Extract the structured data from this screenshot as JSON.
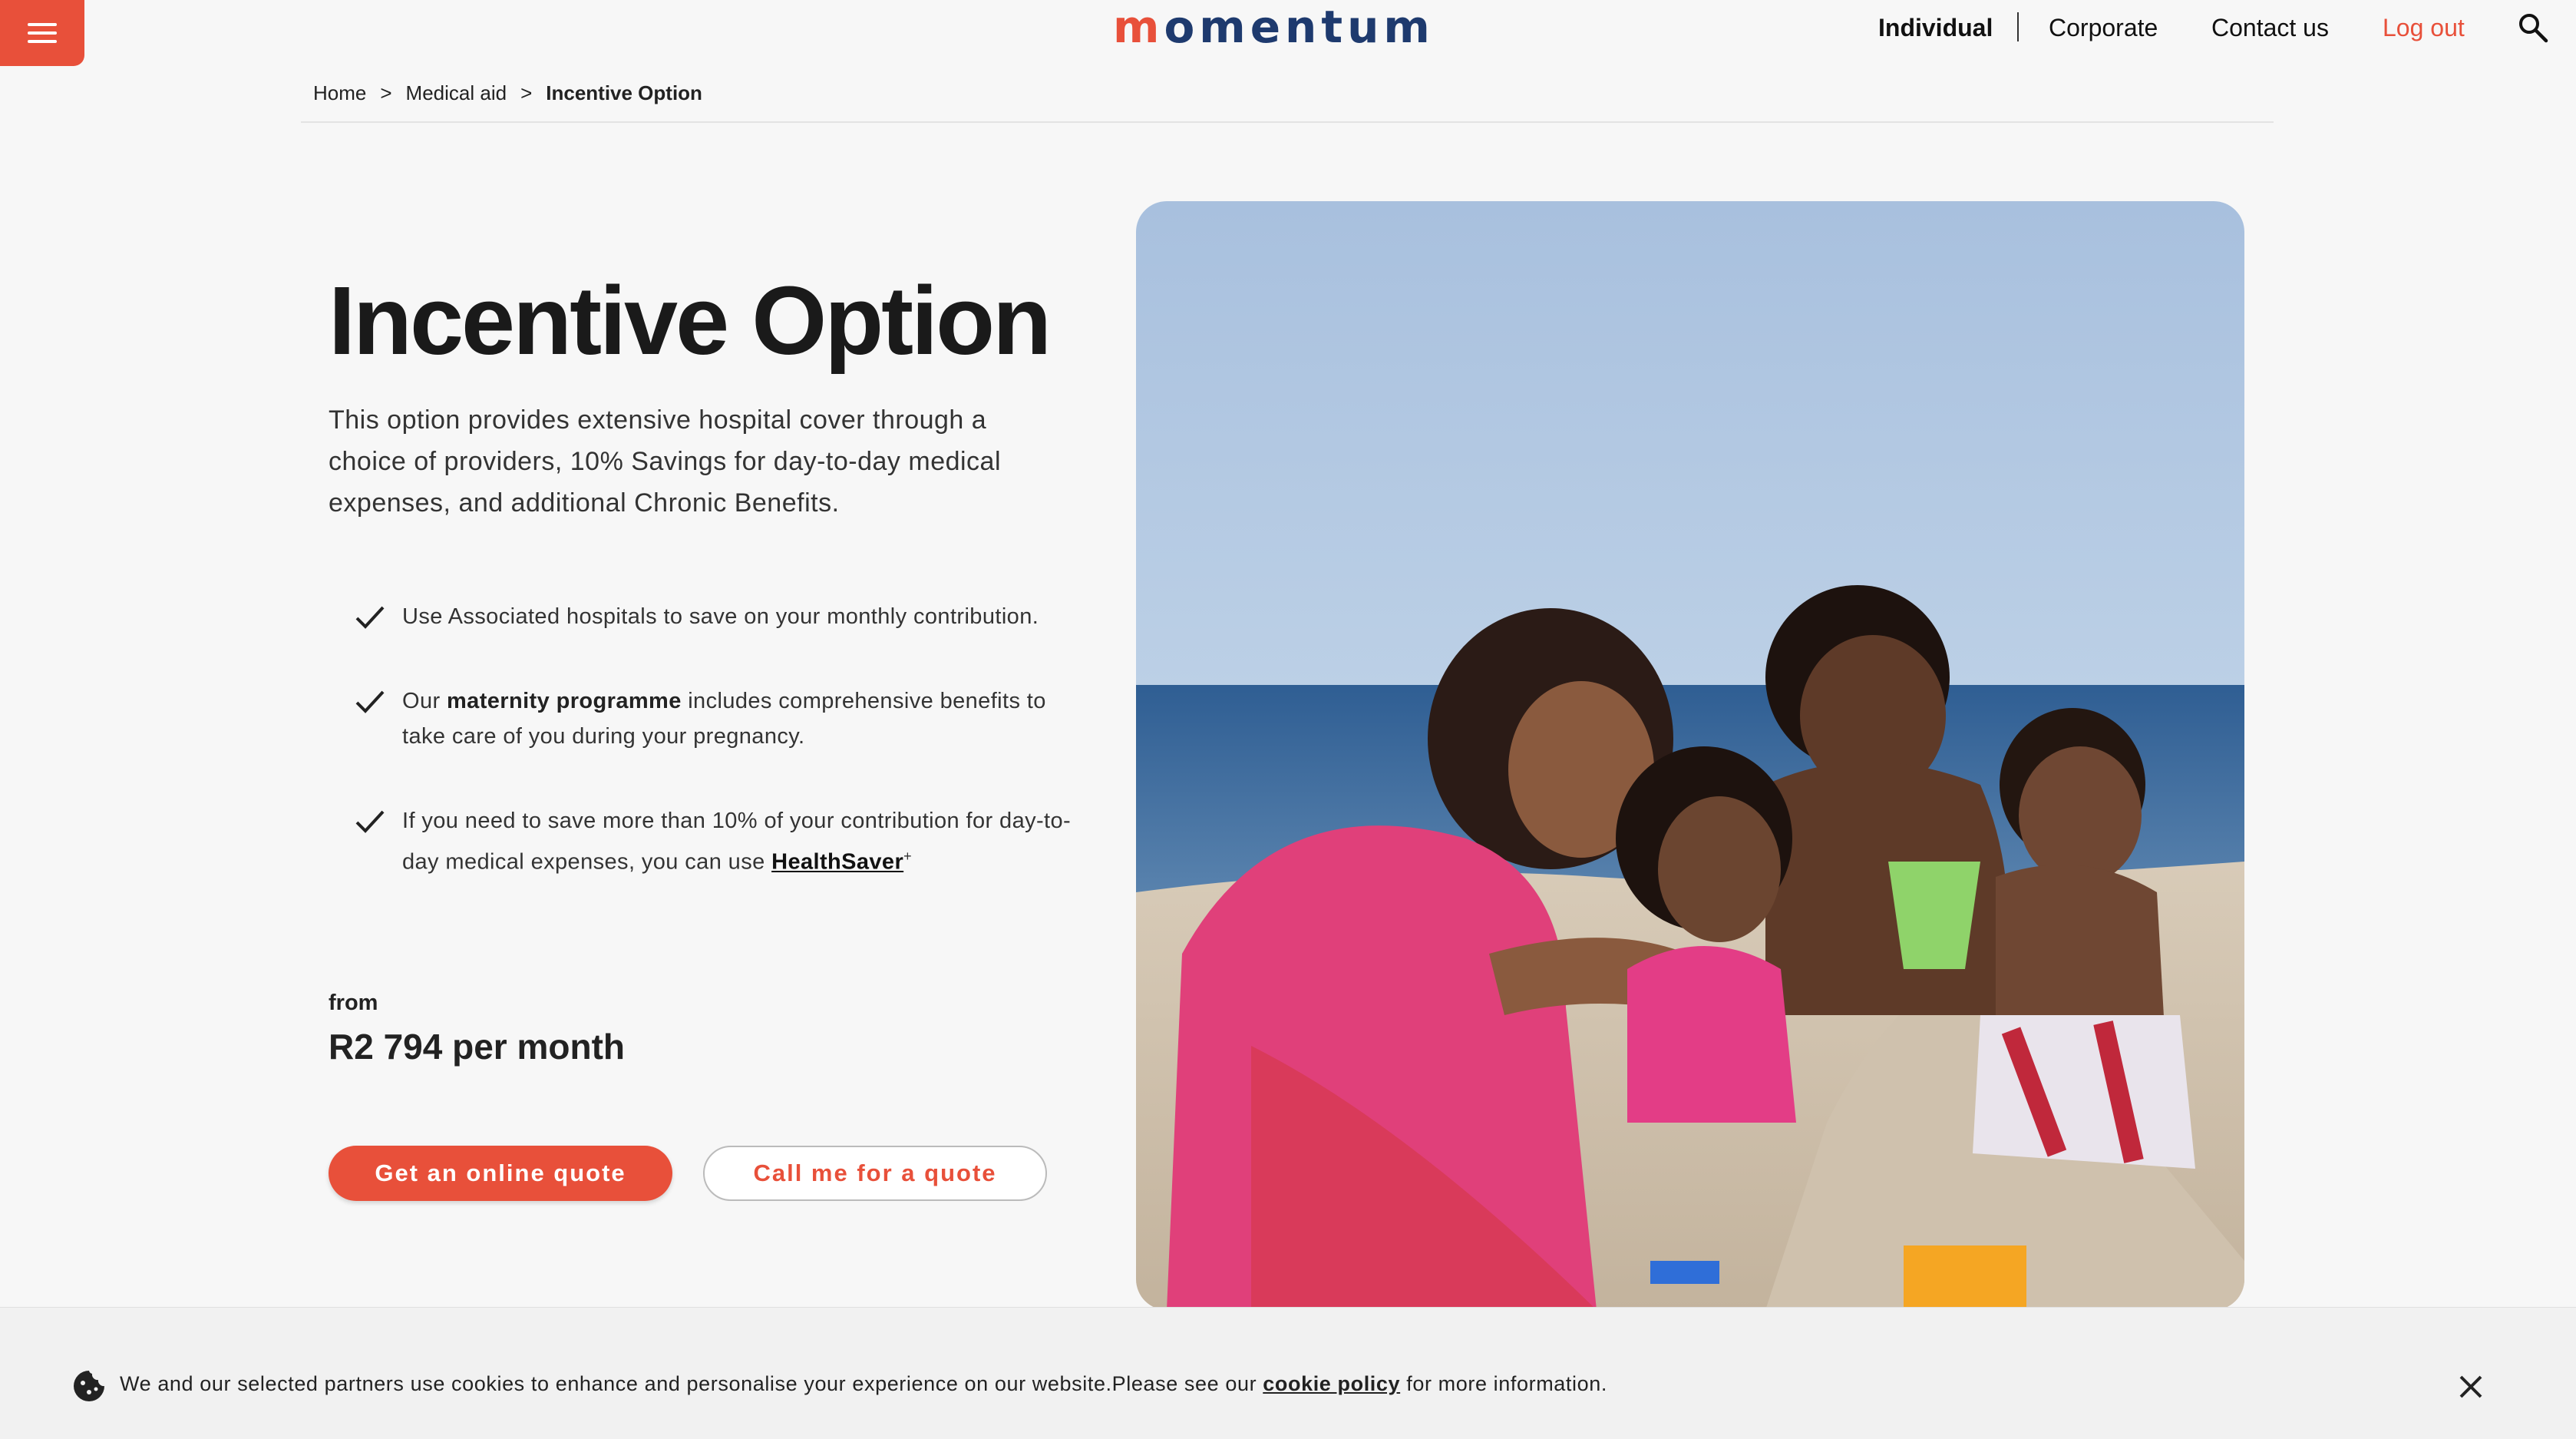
{
  "header": {
    "logo_text": "momentum",
    "nav": {
      "individual": "Individual",
      "corporate": "Corporate",
      "contact": "Contact us",
      "logout": "Log out"
    },
    "icons": [
      "menu-icon",
      "search-icon"
    ],
    "accent_color": "#e8503a",
    "brand_color": "#1e3a6e"
  },
  "breadcrumb": {
    "items": [
      "Home",
      "Medical aid",
      "Incentive Option"
    ],
    "separator": ">"
  },
  "main": {
    "title": "Incentive Option",
    "intro": "This option provides extensive hospital cover through a choice of providers, 10% Savings for day-to-day medical expenses, and additional Chronic Benefits.",
    "features": [
      {
        "text": "Use Associated hospitals to save on your monthly contribution."
      },
      {
        "prefix": "Our ",
        "bold": "maternity programme",
        "suffix": " includes comprehensive benefits to take care of you during your pregnancy."
      },
      {
        "prefix": "If you need to save more than 10% of your contribution for day-to-day medical expenses, you can use ",
        "link": "HealthSaver",
        "sup": "+"
      }
    ],
    "price_from_label": "from",
    "price": "R2 794 per month",
    "cta_primary": "Get an online quote",
    "cta_secondary": "Call me for a quote"
  },
  "cookie_banner": {
    "text_before": "We and our selected partners use cookies to enhance and personalise your experience on our website.Please see our ",
    "link": "cookie policy",
    "text_after": " for more information."
  }
}
